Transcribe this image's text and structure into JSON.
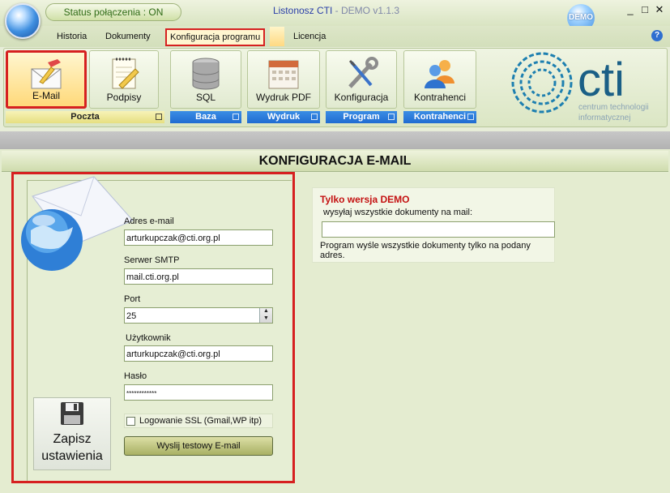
{
  "window": {
    "status_pill": "Status połączenia : ON",
    "title_main": "Listonosz CTI",
    "title_suffix": " - DEMO v1.1.3",
    "demo_badge": "DEMO",
    "minimize": "_",
    "maximize": "□",
    "close": "✕",
    "help": "?"
  },
  "menu": {
    "tabs": [
      "Historia",
      "Dokumenty",
      "Konfiguracja programu",
      "Licencja"
    ],
    "active_tab": "Konfiguracja programu"
  },
  "ribbon": {
    "buttons": [
      {
        "label": "E-Mail",
        "icon": "email-icon",
        "selected": true
      },
      {
        "label": "Podpisy",
        "icon": "signature-icon"
      },
      {
        "label": "SQL",
        "icon": "database-icon"
      },
      {
        "label": "Wydruk PDF",
        "icon": "calendar-pdf-icon"
      },
      {
        "label": "Konfiguracja",
        "icon": "wrench-screwdriver-icon"
      },
      {
        "label": "Kontrahenci",
        "icon": "users-icon"
      }
    ],
    "groups": [
      "Poczta",
      "Baza",
      "Wydruk",
      "Program",
      "Kontrahenci"
    ]
  },
  "logo": {
    "wordmark": "cti",
    "subtitle_line1": "centrum technologii",
    "subtitle_line2": "informatycznej",
    "colors": {
      "ring": "#1d7fb0",
      "text": "#1a5f86"
    }
  },
  "section": {
    "title": "KONFIGURACJA E-MAIL"
  },
  "form": {
    "email_label": "Adres e-mail",
    "email_value": "arturkupczak@cti.org.pl",
    "smtp_label": "Serwer SMTP",
    "smtp_value": "mail.cti.org.pl",
    "port_label": "Port",
    "port_value": "25",
    "user_label": "Użytkownik",
    "user_value": "arturkupczak@cti.org.pl",
    "password_label": "Hasło",
    "password_value": "************",
    "ssl_label": "Logowanie SSL (Gmail,WP itp)",
    "ssl_checked": false,
    "test_button": "Wyslij testowy E-mail",
    "save_button_line1": "Zapisz",
    "save_button_line2": "ustawienia"
  },
  "demo_box": {
    "title": "Tylko wersja DEMO",
    "subtitle": "wysyłaj wszystkie dokumenty na mail:",
    "email_value": "",
    "note": "Program wyśle wszystkie dokumenty tylko na podany adres."
  },
  "colors": {
    "highlight_red": "#d62020",
    "demo_title": "#c41212",
    "group_blue": "#1f6bd1",
    "background": "#e4ecd0"
  }
}
